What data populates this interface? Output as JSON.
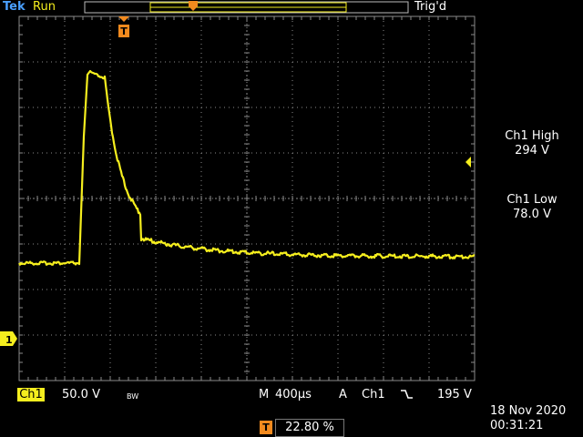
{
  "header": {
    "brand": "Tek",
    "run_state": "Run",
    "trigger_state": "Trig'd"
  },
  "measurements": [
    {
      "title": "Ch1 High",
      "value": "294 V"
    },
    {
      "title": "Ch1 Low",
      "value": "78.0 V"
    }
  ],
  "channel": {
    "label": "Ch1",
    "scale": "50.0 V",
    "bw_limit": "BW",
    "ground_marker": "1"
  },
  "timebase": {
    "mode": "M",
    "scale": "400µs"
  },
  "trigger": {
    "mode": "A",
    "source": "Ch1",
    "slope": "falling",
    "level": "195 V",
    "position_marker": "T",
    "position": "22.80 %"
  },
  "clock": {
    "date": "18 Nov 2020",
    "time": "00:31:21"
  },
  "colors": {
    "trace": "#f5ee1e",
    "grid": "#8a8a8a",
    "trigger_marker": "#f28a1e",
    "channel": "#f5ee1e"
  }
}
